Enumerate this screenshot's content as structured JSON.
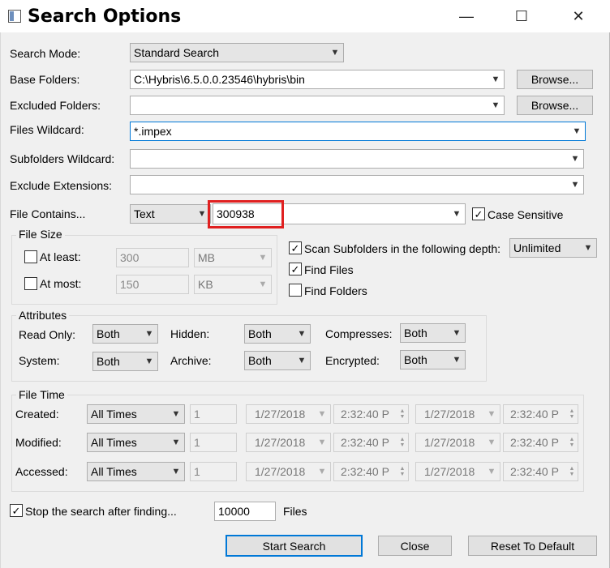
{
  "window": {
    "title": "Search Options",
    "minimize_glyph": "—",
    "maximize_glyph": "☐",
    "close_glyph": "✕"
  },
  "form": {
    "search_mode_label": "Search Mode:",
    "search_mode_value": "Standard Search",
    "base_folders_label": "Base Folders:",
    "base_folders_value": "C:\\Hybris\\6.5.0.0.23546\\hybris\\bin",
    "browse_label": "Browse...",
    "excluded_folders_label": "Excluded Folders:",
    "excluded_folders_value": "",
    "files_wildcard_label": "Files Wildcard:",
    "files_wildcard_value": "*.impex",
    "subfolders_wildcard_label": "Subfolders Wildcard:",
    "subfolders_wildcard_value": "",
    "exclude_extensions_label": "Exclude Extensions:",
    "exclude_extensions_value": "",
    "file_contains_label": "File Contains...",
    "file_contains_type": "Text",
    "file_contains_value": "300938",
    "case_sensitive_label": "Case Sensitive",
    "case_sensitive_checked": true
  },
  "file_size": {
    "title": "File Size",
    "at_least_label": "At least:",
    "at_least_value": "300",
    "at_least_unit": "MB",
    "at_most_label": "At most:",
    "at_most_value": "150",
    "at_most_unit": "KB"
  },
  "scan": {
    "scan_subfolders_label": "Scan Subfolders in the following depth:",
    "depth_value": "Unlimited",
    "find_files_label": "Find Files",
    "find_folders_label": "Find Folders"
  },
  "attributes": {
    "title": "Attributes",
    "read_only_label": "Read Only:",
    "read_only_value": "Both",
    "hidden_label": "Hidden:",
    "hidden_value": "Both",
    "compresses_label": "Compresses:",
    "compresses_value": "Both",
    "system_label": "System:",
    "system_value": "Both",
    "archive_label": "Archive:",
    "archive_value": "Both",
    "encrypted_label": "Encrypted:",
    "encrypted_value": "Both"
  },
  "file_time": {
    "title": "File Time",
    "rows": [
      {
        "label": "Created:",
        "mode": "All Times",
        "num": "1",
        "date1": "1/27/2018",
        "time1": "2:32:40 P",
        "date2": "1/27/2018",
        "time2": "2:32:40 P"
      },
      {
        "label": "Modified:",
        "mode": "All Times",
        "num": "1",
        "date1": "1/27/2018",
        "time1": "2:32:40 P",
        "date2": "1/27/2018",
        "time2": "2:32:40 P"
      },
      {
        "label": "Accessed:",
        "mode": "All Times",
        "num": "1",
        "date1": "1/27/2018",
        "time1": "2:32:40 P",
        "date2": "1/27/2018",
        "time2": "2:32:40 P"
      }
    ]
  },
  "stop": {
    "label": "Stop the search after finding...",
    "value": "10000",
    "suffix": "Files"
  },
  "buttons": {
    "start_search": "Start Search",
    "close": "Close",
    "reset_to_default": "Reset To Default"
  },
  "colors": {
    "highlight_box": "#e02020",
    "focus_border": "#0078d7"
  }
}
